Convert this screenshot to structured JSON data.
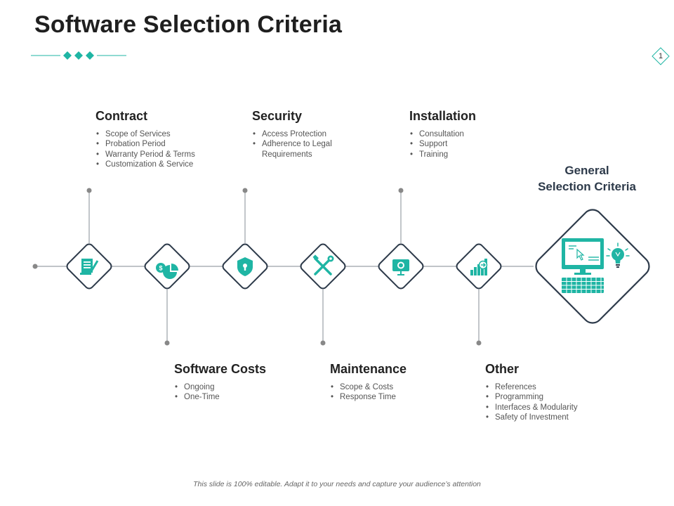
{
  "title": "Software Selection Criteria",
  "page_number": "1",
  "colors": {
    "accent": "#1fb5a4",
    "outline": "#2d3a4a",
    "line": "#9aa0a6",
    "dot": "#888888"
  },
  "criteria_top": [
    {
      "heading": "Contract",
      "icon": "contract-document-icon",
      "items": [
        "Scope of Services",
        "Probation Period",
        "Warranty Period & Terms",
        "Customization & Service"
      ]
    },
    {
      "heading": "Security",
      "icon": "security-shield-icon",
      "items": [
        "Access Protection",
        "Adherence to Legal",
        "Requirements"
      ]
    },
    {
      "heading": "Installation",
      "icon": "installation-monitor-icon",
      "items": [
        "Consultation",
        "Support",
        "Training"
      ]
    }
  ],
  "criteria_bottom": [
    {
      "heading": "Software Costs",
      "icon": "costs-chart-icon",
      "items": [
        "Ongoing",
        "One-Time"
      ]
    },
    {
      "heading": "Maintenance",
      "icon": "maintenance-tools-icon",
      "items": [
        "Scope & Costs",
        "Response Time"
      ]
    },
    {
      "heading": "Other",
      "icon": "other-growth-icon",
      "items": [
        "References",
        "Programming",
        "Interfaces & Modularity",
        "Safety of Investment"
      ]
    }
  ],
  "general": {
    "line1": "General",
    "line2": "Selection Criteria",
    "icon": "computer-idea-icon"
  },
  "footer": "This slide is 100% editable. Adapt it to your needs and capture your audience’s attention"
}
